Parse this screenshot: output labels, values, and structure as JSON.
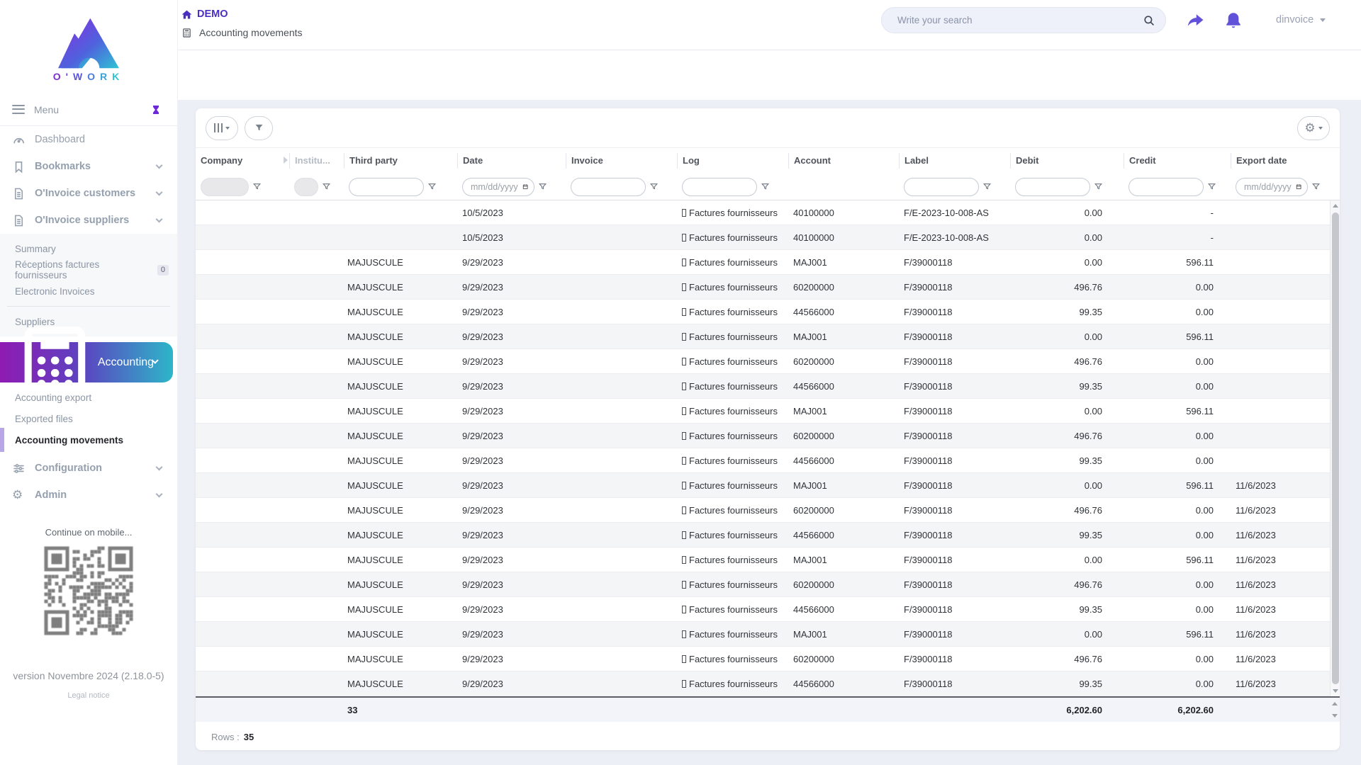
{
  "topbar": {
    "breadcrumb_home": "DEMO",
    "breadcrumb_page": "Accounting movements",
    "search_placeholder": "Write your search",
    "user": "dinvoice"
  },
  "sidebar": {
    "wordmark": "O'WORK",
    "wordmark_colors": [
      "#7a2fd0",
      "#6a3fd8",
      "#5b55dd",
      "#4a7ae0",
      "#3aa3d8",
      "#2fc4d4"
    ],
    "menu_label": "Menu",
    "dashboard": "Dashboard",
    "bookmarks": "Bookmarks",
    "oinvoice_customers": "O'Invoice customers",
    "oinvoice_suppliers": "O'Invoice suppliers",
    "suppliers_submenu": {
      "summary": "Summary",
      "receptions": "Réceptions factures fournisseurs",
      "receptions_badge": "0",
      "electronic": "Electronic Invoices",
      "suppliers": "Suppliers"
    },
    "accounting": "Accounting",
    "accounting_submenu": {
      "export": "Accounting export",
      "exported_files": "Exported files",
      "movements": "Accounting movements"
    },
    "configuration": "Configuration",
    "admin": "Admin",
    "mobile_hint": "Continue on mobile...",
    "version": "version Novembre 2024 (2.18.0-5)",
    "legal_notice": "Legal notice"
  },
  "table": {
    "columns": {
      "company": "Company",
      "institution": "Institu...",
      "third_party": "Third party",
      "date": "Date",
      "invoice": "Invoice",
      "log": "Log",
      "account": "Account",
      "label": "Label",
      "debit": "Debit",
      "credit": "Credit",
      "export_date": "Export date"
    },
    "date_placeholder": "mm/dd/yyyy",
    "rows": [
      {
        "company": "",
        "institution": "",
        "third_party": "",
        "date": "10/5/2023",
        "invoice": "",
        "log": "Factures fournisseurs",
        "account": "40100000",
        "label": "F/E-2023-10-008-AS",
        "debit": "0.00",
        "credit": "-",
        "export_date": ""
      },
      {
        "company": "",
        "institution": "",
        "third_party": "",
        "date": "10/5/2023",
        "invoice": "",
        "log": "Factures fournisseurs",
        "account": "40100000",
        "label": "F/E-2023-10-008-AS",
        "debit": "0.00",
        "credit": "-",
        "export_date": ""
      },
      {
        "company": "",
        "institution": "",
        "third_party": "MAJUSCULE",
        "date": "9/29/2023",
        "invoice": "",
        "log": "Factures fournisseurs",
        "account": "MAJ001",
        "label": "F/39000118",
        "debit": "0.00",
        "credit": "596.11",
        "export_date": ""
      },
      {
        "company": "",
        "institution": "",
        "third_party": "MAJUSCULE",
        "date": "9/29/2023",
        "invoice": "",
        "log": "Factures fournisseurs",
        "account": "60200000",
        "label": "F/39000118",
        "debit": "496.76",
        "credit": "0.00",
        "export_date": ""
      },
      {
        "company": "",
        "institution": "",
        "third_party": "MAJUSCULE",
        "date": "9/29/2023",
        "invoice": "",
        "log": "Factures fournisseurs",
        "account": "44566000",
        "label": "F/39000118",
        "debit": "99.35",
        "credit": "0.00",
        "export_date": ""
      },
      {
        "company": "",
        "institution": "",
        "third_party": "MAJUSCULE",
        "date": "9/29/2023",
        "invoice": "",
        "log": "Factures fournisseurs",
        "account": "MAJ001",
        "label": "F/39000118",
        "debit": "0.00",
        "credit": "596.11",
        "export_date": ""
      },
      {
        "company": "",
        "institution": "",
        "third_party": "MAJUSCULE",
        "date": "9/29/2023",
        "invoice": "",
        "log": "Factures fournisseurs",
        "account": "60200000",
        "label": "F/39000118",
        "debit": "496.76",
        "credit": "0.00",
        "export_date": ""
      },
      {
        "company": "",
        "institution": "",
        "third_party": "MAJUSCULE",
        "date": "9/29/2023",
        "invoice": "",
        "log": "Factures fournisseurs",
        "account": "44566000",
        "label": "F/39000118",
        "debit": "99.35",
        "credit": "0.00",
        "export_date": ""
      },
      {
        "company": "",
        "institution": "",
        "third_party": "MAJUSCULE",
        "date": "9/29/2023",
        "invoice": "",
        "log": "Factures fournisseurs",
        "account": "MAJ001",
        "label": "F/39000118",
        "debit": "0.00",
        "credit": "596.11",
        "export_date": ""
      },
      {
        "company": "",
        "institution": "",
        "third_party": "MAJUSCULE",
        "date": "9/29/2023",
        "invoice": "",
        "log": "Factures fournisseurs",
        "account": "60200000",
        "label": "F/39000118",
        "debit": "496.76",
        "credit": "0.00",
        "export_date": ""
      },
      {
        "company": "",
        "institution": "",
        "third_party": "MAJUSCULE",
        "date": "9/29/2023",
        "invoice": "",
        "log": "Factures fournisseurs",
        "account": "44566000",
        "label": "F/39000118",
        "debit": "99.35",
        "credit": "0.00",
        "export_date": ""
      },
      {
        "company": "",
        "institution": "",
        "third_party": "MAJUSCULE",
        "date": "9/29/2023",
        "invoice": "",
        "log": "Factures fournisseurs",
        "account": "MAJ001",
        "label": "F/39000118",
        "debit": "0.00",
        "credit": "596.11",
        "export_date": "11/6/2023"
      },
      {
        "company": "",
        "institution": "",
        "third_party": "MAJUSCULE",
        "date": "9/29/2023",
        "invoice": "",
        "log": "Factures fournisseurs",
        "account": "60200000",
        "label": "F/39000118",
        "debit": "496.76",
        "credit": "0.00",
        "export_date": "11/6/2023"
      },
      {
        "company": "",
        "institution": "",
        "third_party": "MAJUSCULE",
        "date": "9/29/2023",
        "invoice": "",
        "log": "Factures fournisseurs",
        "account": "44566000",
        "label": "F/39000118",
        "debit": "99.35",
        "credit": "0.00",
        "export_date": "11/6/2023"
      },
      {
        "company": "",
        "institution": "",
        "third_party": "MAJUSCULE",
        "date": "9/29/2023",
        "invoice": "",
        "log": "Factures fournisseurs",
        "account": "MAJ001",
        "label": "F/39000118",
        "debit": "0.00",
        "credit": "596.11",
        "export_date": "11/6/2023"
      },
      {
        "company": "",
        "institution": "",
        "third_party": "MAJUSCULE",
        "date": "9/29/2023",
        "invoice": "",
        "log": "Factures fournisseurs",
        "account": "60200000",
        "label": "F/39000118",
        "debit": "496.76",
        "credit": "0.00",
        "export_date": "11/6/2023"
      },
      {
        "company": "",
        "institution": "",
        "third_party": "MAJUSCULE",
        "date": "9/29/2023",
        "invoice": "",
        "log": "Factures fournisseurs",
        "account": "44566000",
        "label": "F/39000118",
        "debit": "99.35",
        "credit": "0.00",
        "export_date": "11/6/2023"
      },
      {
        "company": "",
        "institution": "",
        "third_party": "MAJUSCULE",
        "date": "9/29/2023",
        "invoice": "",
        "log": "Factures fournisseurs",
        "account": "MAJ001",
        "label": "F/39000118",
        "debit": "0.00",
        "credit": "596.11",
        "export_date": "11/6/2023"
      },
      {
        "company": "",
        "institution": "",
        "third_party": "MAJUSCULE",
        "date": "9/29/2023",
        "invoice": "",
        "log": "Factures fournisseurs",
        "account": "60200000",
        "label": "F/39000118",
        "debit": "496.76",
        "credit": "0.00",
        "export_date": "11/6/2023"
      },
      {
        "company": "",
        "institution": "",
        "third_party": "MAJUSCULE",
        "date": "9/29/2023",
        "invoice": "",
        "log": "Factures fournisseurs",
        "account": "44566000",
        "label": "F/39000118",
        "debit": "99.35",
        "credit": "0.00",
        "export_date": "11/6/2023"
      }
    ],
    "totals": {
      "count": "33",
      "debit": "6,202.60",
      "credit": "6,202.60"
    },
    "footer": {
      "rows_label": "Rows :",
      "rows_value": "35"
    }
  },
  "colors": {
    "accent_purple": "#5f45d6",
    "brand_crumb": "#4b2ec2",
    "gradient_start": "#8f1bb3",
    "gradient_mid": "#5b44c0",
    "gradient_end": "#2db6c9",
    "active_bar": "#b7a7e6"
  }
}
